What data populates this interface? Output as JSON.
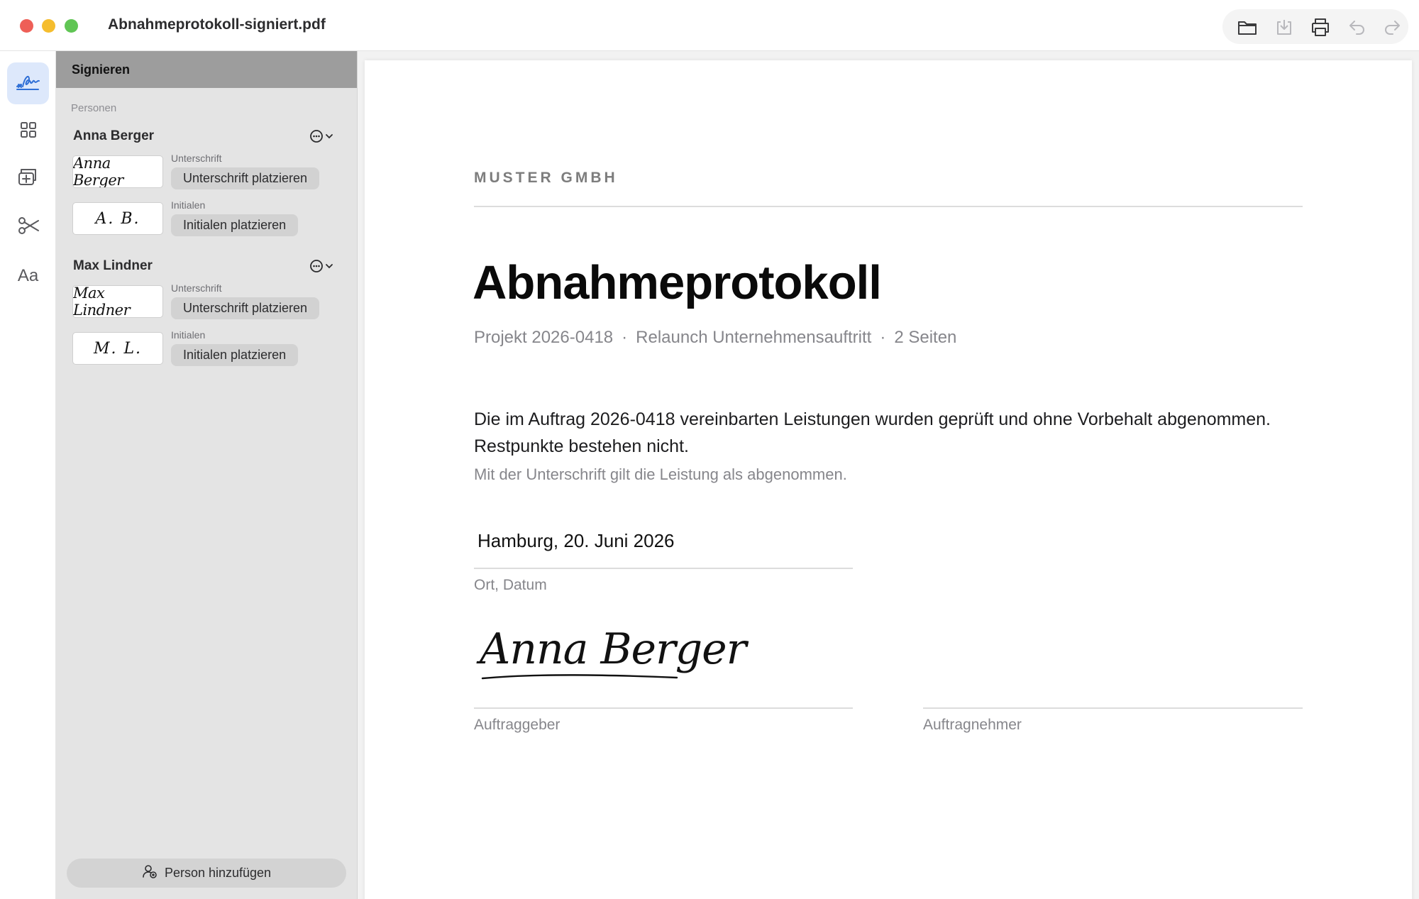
{
  "window": {
    "title": "Abnahmeprotokoll-signiert.pdf"
  },
  "toolbar": {
    "icons": [
      "folder-icon",
      "download-icon",
      "print-icon",
      "undo-icon",
      "redo-icon"
    ]
  },
  "rail": {
    "items": [
      "signature-icon",
      "grid-icon",
      "add-page-icon",
      "scissors-icon",
      "Aa"
    ]
  },
  "sidebar": {
    "header": "Signieren",
    "section_label": "Personen",
    "persons": [
      {
        "name": "Anna Berger",
        "signature_label": "Unterschrift",
        "signature_preview": "Anna Berger",
        "place_signature": "Unterschrift platzieren",
        "initials_label": "Initialen",
        "initials_preview": "A. B.",
        "place_initials": "Initialen platzieren"
      },
      {
        "name": "Max Lindner",
        "signature_label": "Unterschrift",
        "signature_preview": "Max Lindner",
        "place_signature": "Unterschrift platzieren",
        "initials_label": "Initialen",
        "initials_preview": "M. L.",
        "place_initials": "Initialen platzieren"
      }
    ],
    "add_person": "Person hinzufügen"
  },
  "document": {
    "company": "MUSTER GMBH",
    "title": "Abnahmeprotokoll",
    "meta": {
      "project": "Projekt 2026-0418",
      "subject": "Relaunch Unternehmensauftritt",
      "pages": "2 Seiten"
    },
    "body": "Die im Auftrag 2026-0418 vereinbarten Leistungen wurden geprüft und ohne Vorbehalt abgenommen. Restpunkte bestehen nicht.",
    "note": "Mit der Unterschrift gilt die Leistung als abgenommen.",
    "date_value": "Hamburg, 20. Juni 2026",
    "date_label": "Ort, Datum",
    "signature_text": "Anna Berger",
    "client_label": "Auftraggeber",
    "contractor_label": "Auftragnehmer"
  }
}
